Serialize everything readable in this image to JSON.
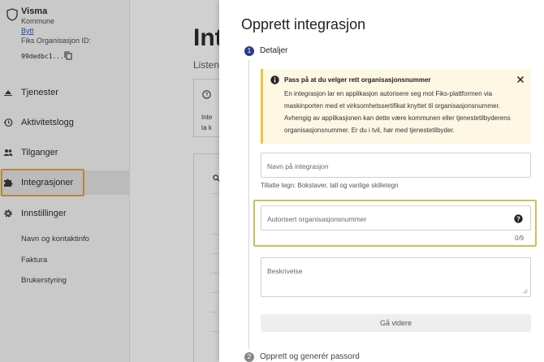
{
  "sidebar": {
    "org_name": "Visma",
    "org_type": "Kommune",
    "switch_label": "Bytt",
    "org_id_label": "Fiks Organisasjon ID:",
    "org_id": "99dedbc1...",
    "nav": [
      {
        "label": "Tjenester",
        "icon": "services-icon"
      },
      {
        "label": "Aktivitetslogg",
        "icon": "history-icon"
      },
      {
        "label": "Tilganger",
        "icon": "people-icon"
      },
      {
        "label": "Integrasjoner",
        "icon": "puzzle-icon"
      },
      {
        "label": "Innstillinger",
        "icon": "gear-icon"
      }
    ],
    "sub_items": [
      "Navn og kontaktinfo",
      "Faktura",
      "Brukerstyring"
    ]
  },
  "main": {
    "title": "Int",
    "subtitle": "Listen",
    "info_text": "Inte\nta k"
  },
  "panel": {
    "title": "Opprett integrasjon",
    "steps": [
      {
        "number": "1",
        "label": "Detaljer"
      },
      {
        "number": "2",
        "label": "Opprett og generér passord"
      }
    ],
    "alert": {
      "title": "Pass på at du velger rett organisasjonsnummer",
      "body": "En integrasjon lar en applikasjon autorisere seg mot Fiks-plattformen via maskinporten med et virksomhetssertifikat knyttet til organisasjonsnummer. Avhengig av applikasjonen kan dette være kommunen eller tjenestetilbyderens organisasjonsnummer. Er du i tvil, hør med tjenestetilbyder."
    },
    "name_field": {
      "placeholder": "Navn på integrasjon",
      "helper": "Tillatte tegn: Bokstaver, tall og vanlige skilletegn"
    },
    "orgnr_field": {
      "placeholder": "Autorisert organisasjonsnummer",
      "counter": "0/9"
    },
    "desc_field": {
      "placeholder": "Beskrivelse"
    },
    "next_button": "Gå videre"
  },
  "colors": {
    "accent": "#2d3a8c",
    "alert_bg": "#fdf7e4",
    "alert_border": "#f0c24b",
    "highlight_orange": "#e0a23c",
    "highlight_olive": "#c7c25c"
  }
}
